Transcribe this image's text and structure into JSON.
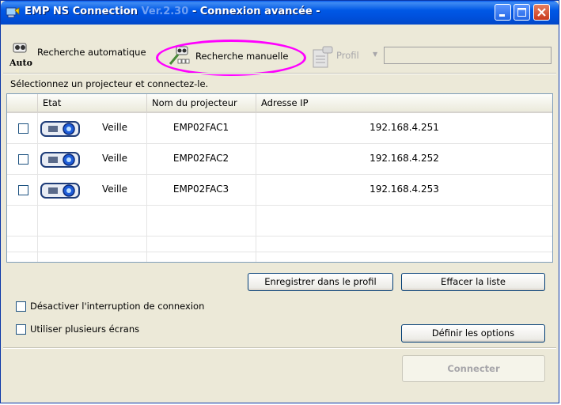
{
  "window": {
    "title": "EMP NS Connection",
    "version": "Ver.2.30",
    "subtitle": " - Connexion avancée -"
  },
  "toolbar": {
    "auto_icon_text": "Auto",
    "auto_search_label": "Recherche automatique",
    "manual_search_label": "Recherche manuelle",
    "profile_label": "Profil",
    "profile_value": ""
  },
  "instruction": "Sélectionnez un projecteur et connectez-le.",
  "table": {
    "columns": [
      "",
      "Etat",
      "Nom du projecteur",
      "Adresse IP"
    ],
    "rows": [
      {
        "state": "Veille",
        "name": "EMP02FAC1",
        "ip": "192.168.4.251"
      },
      {
        "state": "Veille",
        "name": "EMP02FAC2",
        "ip": "192.168.4.252"
      },
      {
        "state": "Veille",
        "name": "EMP02FAC3",
        "ip": "192.168.4.253"
      }
    ]
  },
  "buttons": {
    "save_profile": "Enregistrer dans le profil",
    "clear_list": "Effacer la liste",
    "set_options": "Définir les options",
    "connect": "Connecter"
  },
  "options": {
    "disable_interrupt": "Désactiver l'interruption de connexion",
    "multi_screen": "Utiliser plusieurs écrans"
  },
  "colors": {
    "title_bar": "#0058e6",
    "highlight": "#ff00ff",
    "window_bg": "#ece9d8"
  }
}
